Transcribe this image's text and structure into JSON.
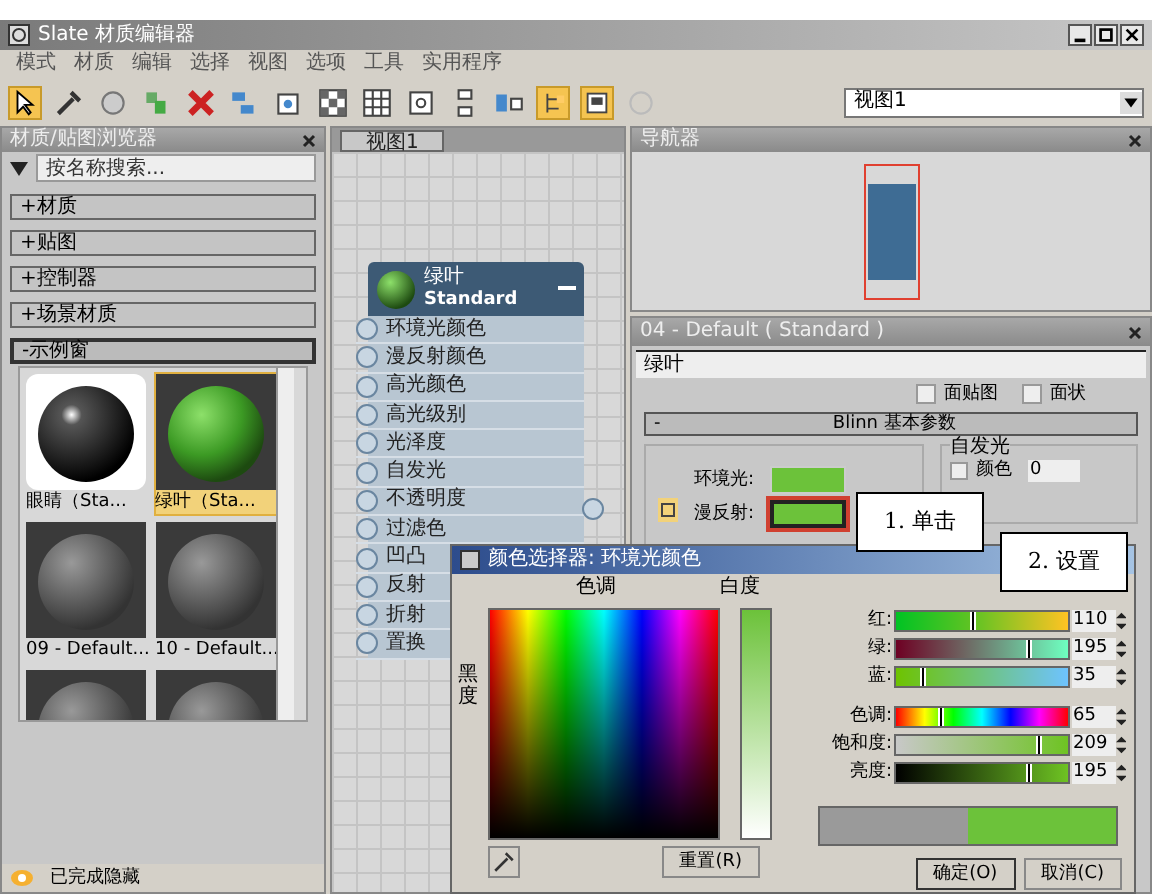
{
  "window": {
    "title": "Slate 材质编辑器"
  },
  "menu": [
    "模式",
    "材质",
    "编辑",
    "选择",
    "视图",
    "选项",
    "工具",
    "实用程序"
  ],
  "toolbar": {
    "view_select": "视图1"
  },
  "browser": {
    "title": "材质/贴图浏览器",
    "search_placeholder": "按名称搜索...",
    "groups": [
      {
        "sign": "+",
        "label": "材质",
        "expanded": false
      },
      {
        "sign": "+",
        "label": "贴图",
        "expanded": false
      },
      {
        "sign": "+",
        "label": "控制器",
        "expanded": false
      },
      {
        "sign": "+",
        "label": "场景材质",
        "expanded": false
      },
      {
        "sign": "-",
        "label": "示例窗",
        "expanded": true
      }
    ],
    "samples": [
      {
        "kind": "black",
        "label": "眼睛（Sta...",
        "selected": false
      },
      {
        "kind": "green",
        "label": "绿叶（Sta...",
        "selected": true
      },
      {
        "kind": "gray",
        "label": "09 - Default...",
        "selected": false
      },
      {
        "kind": "gray",
        "label": "10 - Default...",
        "selected": false
      },
      {
        "kind": "gray",
        "selected": false
      },
      {
        "kind": "gray",
        "selected": false
      }
    ]
  },
  "view": {
    "tab": "视图1",
    "node": {
      "title": "绿叶",
      "subtitle": "Standard",
      "slots": [
        "环境光颜色",
        "漫反射颜色",
        "高光颜色",
        "高光级别",
        "光泽度",
        "自发光",
        "不透明度",
        "过滤色",
        "凹凸",
        "反射",
        "折射",
        "置换"
      ]
    }
  },
  "navigator": {
    "title": "导航器"
  },
  "params": {
    "title": "04 - Default ( Standard )",
    "name": "绿叶",
    "checks": [
      {
        "label": "面贴图",
        "checked": false
      },
      {
        "label": "面状",
        "checked": false
      }
    ],
    "rollout": {
      "sign": "-",
      "title": "Blinn 基本参数"
    },
    "self_illum": {
      "title": "自发光",
      "label": "颜色",
      "checked": false,
      "value": "0"
    },
    "swatches": [
      {
        "label": "环境光:",
        "color": "#6cc23a",
        "selected": false
      },
      {
        "label": "漫反射:",
        "color": "#6cc23a",
        "selected": true
      }
    ]
  },
  "dialog": {
    "title": "颜色选择器: 环境光颜色",
    "hue_label": "色调",
    "white_label": "白度",
    "black_label": "黑度",
    "channels": [
      {
        "kind": "red",
        "label": "红:",
        "value": "110",
        "level": 0.43
      },
      {
        "kind": "green",
        "label": "绿:",
        "value": "195",
        "level": 0.76
      },
      {
        "kind": "blue",
        "label": "蓝:",
        "value": "35",
        "level": 0.14
      },
      {
        "kind": "hue",
        "label": "色调:",
        "value": "65",
        "level": 0.25
      },
      {
        "kind": "sat",
        "label": "饱和度:",
        "value": "209",
        "level": 0.82
      },
      {
        "kind": "val",
        "label": "亮度:",
        "value": "195",
        "level": 0.76
      }
    ],
    "reset": "重置(R)",
    "ok": "确定(O)",
    "cancel": "取消(C)"
  },
  "callouts": [
    "1. 单击",
    "2. 设置"
  ],
  "status": "已完成隐藏"
}
